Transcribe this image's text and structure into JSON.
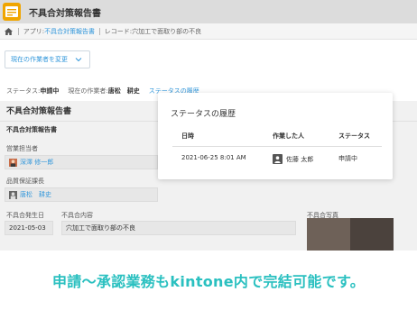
{
  "header": {
    "title": "不具合対策報告書",
    "app_icon": "report-app-icon"
  },
  "breadcrumb": {
    "home_icon": "home-icon",
    "app_prefix": "アプリ:",
    "app_name": "不具合対策報告書",
    "record_label": "レコード:穴加工で面取り部の不良"
  },
  "actions": {
    "change_assignee": "現在の作業者を変更"
  },
  "status": {
    "status_label": "ステータス:",
    "status_value": "申請中",
    "assignee_label": "現在の作業者:",
    "assignee_value": "唐松　耕史",
    "history_link": "ステータスの履歴"
  },
  "form": {
    "title": "不具合対策報告書",
    "section_title": "不具合対策報告書",
    "fields": {
      "sales_rep_label": "営業担当者",
      "sales_rep_value": "深澤 修一郎",
      "qa_manager_label": "品質保証課長",
      "qa_manager_value": "唐松　耕史",
      "date_label": "不具合発生日",
      "date_value": "2021-05-03",
      "content_label": "不具合内容",
      "content_value": "穴加工で面取り部の不良",
      "photo_label": "不具合写真"
    }
  },
  "status_history": {
    "title": "ステータスの履歴",
    "columns": [
      "日時",
      "作業した人",
      "ステータス"
    ],
    "rows": [
      {
        "datetime": "2021-06-25 8:01 AM",
        "person": "佐藤 太郎",
        "status": "申請中"
      }
    ]
  },
  "caption": "申請〜承認業務もkintone内で完結可能です。",
  "colors": {
    "accent_link": "#3498db",
    "caption": "#2ac0c0",
    "app_icon": "#f0a500"
  }
}
